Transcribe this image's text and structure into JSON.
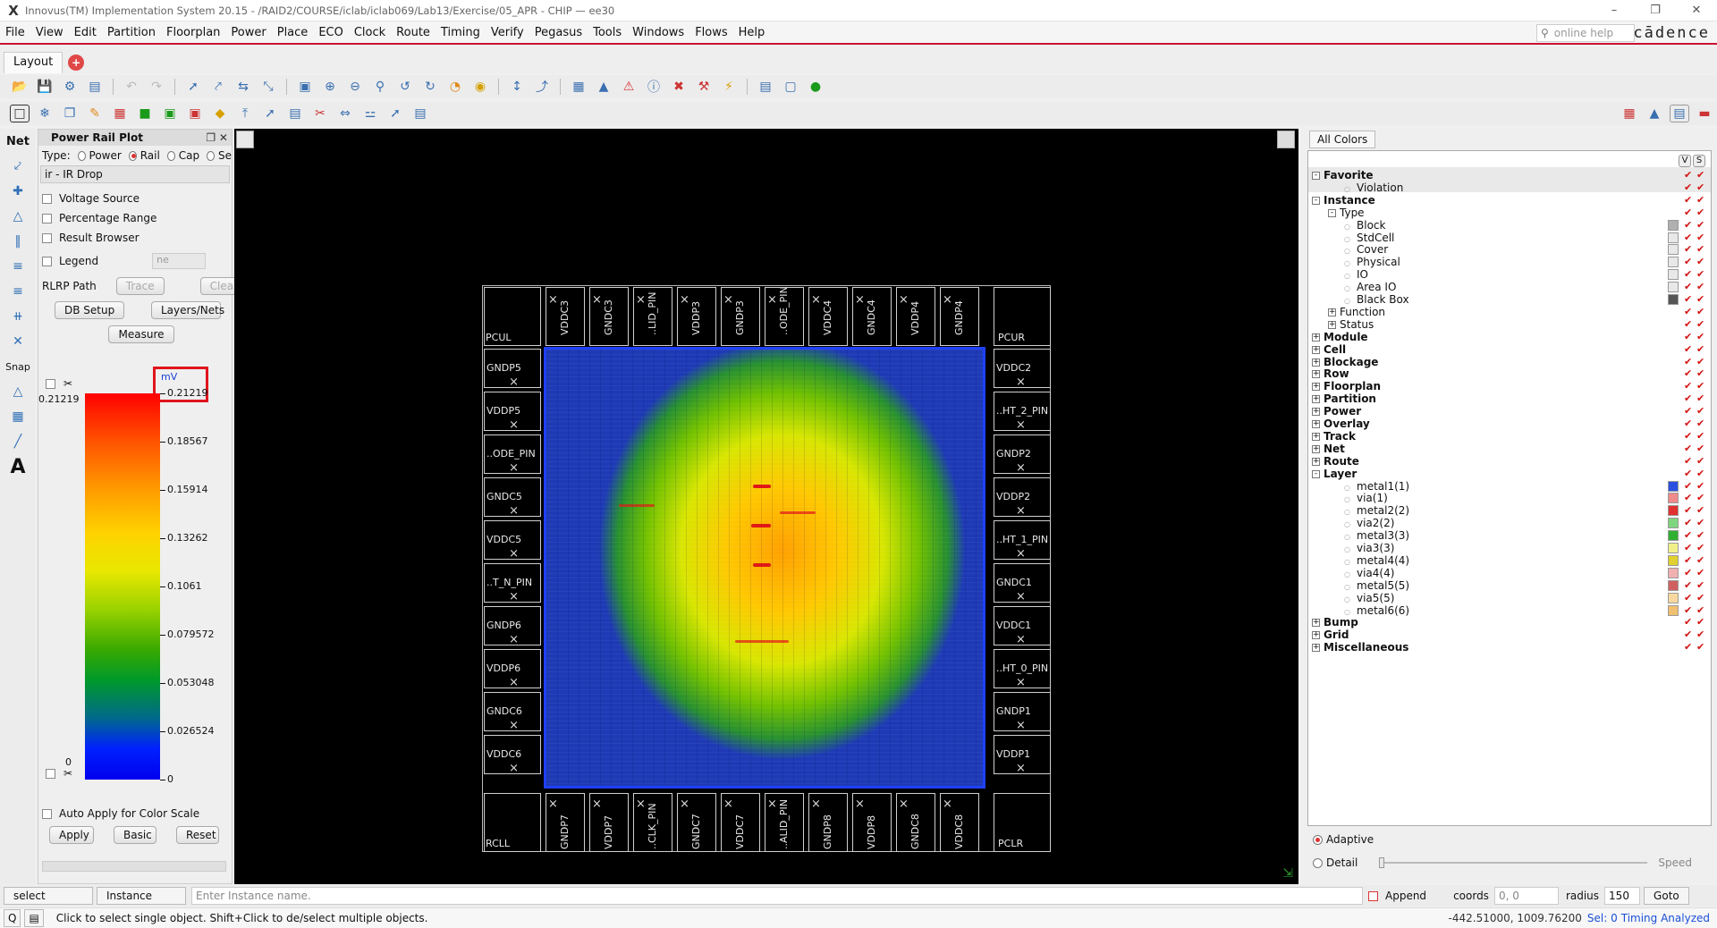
{
  "window": {
    "title": "Innovus(TM) Implementation System 20.15 - /RAID2/COURSE/iclab/iclab069/Lab13/Exercise/05_APR - CHIP — ee30"
  },
  "menu": [
    "File",
    "View",
    "Edit",
    "Partition",
    "Floorplan",
    "Power",
    "Place",
    "ECO",
    "Clock",
    "Route",
    "Timing",
    "Verify",
    "Pegasus",
    "Tools",
    "Windows",
    "Flows",
    "Help"
  ],
  "search": {
    "placeholder": "online help"
  },
  "brand": "cādence",
  "tabs": [
    {
      "label": "Layout"
    }
  ],
  "left_tools": {
    "net_label": "Net",
    "snap_label": "Snap",
    "text_tool": "A"
  },
  "power_rail_plot": {
    "title": "Power Rail Plot",
    "type_label": "Type:",
    "types": [
      "Power",
      "Rail",
      "Cap",
      "Se"
    ],
    "selected_type": "Rail",
    "analysis": "ir - IR Drop",
    "options": [
      "Voltage Source",
      "Percentage Range",
      "Result Browser"
    ],
    "legend_label": "Legend",
    "legend_select": "ne",
    "rlrp_label": "RLRP Path",
    "trace_label": "Trace",
    "clear_label": "Clear",
    "db_setup_label": "DB Setup",
    "layers_nets_label": "Layers/Nets",
    "measure_label": "Measure",
    "unit": "mV",
    "max_value": "0.21219",
    "scale_ticks": [
      "0.21219",
      "0.18567",
      "0.15914",
      "0.13262",
      "0.1061",
      "0.079572",
      "0.053048",
      "0.026524",
      "0"
    ],
    "min_left": "0",
    "auto_apply_label": "Auto Apply for Color Scale",
    "apply_label": "Apply",
    "basic_label": "Basic",
    "reset_label": "Reset"
  },
  "layout": {
    "corners": [
      "PCUL",
      "PCUR",
      "RCLL",
      "PCLR"
    ],
    "top_pads": [
      "VDDC3",
      "GNDC3",
      "..LID_PIN",
      "VDDP3",
      "GNDP3",
      "..ODE_PIN",
      "VDDC4",
      "GNDC4",
      "VDDP4",
      "GNDP4"
    ],
    "bottom_pads": [
      "GNDP7",
      "VDDP7",
      "..CLK_PIN",
      "GNDC7",
      "VDDC7",
      "..ALID_PIN",
      "GNDP8",
      "VDDP8",
      "GNDC8",
      "VDDC8"
    ],
    "left_pads": [
      "GNDP5",
      "VDDP5",
      "..ODE_PIN",
      "GNDC5",
      "VDDC5",
      "..T_N_PIN",
      "GNDP6",
      "VDDP6",
      "GNDC6",
      "VDDC6"
    ],
    "right_pads": [
      "VDDC2",
      "..HT_2_PIN",
      "GNDP2",
      "VDDP2",
      "..HT_1_PIN",
      "GNDC1",
      "VDDC1",
      "..HT_0_PIN",
      "GNDP1",
      "VDDP1"
    ]
  },
  "color_panel": {
    "all_colors_label": "All Colors",
    "v_label": "V",
    "s_label": "S",
    "tree": [
      {
        "label": "Favorite",
        "level": 0,
        "bold": true,
        "exp": "-"
      },
      {
        "label": "Violation",
        "level": 2,
        "bold": false,
        "exp": ""
      },
      {
        "label": "Instance",
        "level": 0,
        "bold": true,
        "exp": "-"
      },
      {
        "label": "Type",
        "level": 1,
        "bold": false,
        "exp": "-"
      },
      {
        "label": "Block",
        "level": 2,
        "bold": false,
        "exp": "",
        "sw": "#b0b0b0"
      },
      {
        "label": "StdCell",
        "level": 2,
        "bold": false,
        "exp": "",
        "sw": "#e8e8e8"
      },
      {
        "label": "Cover",
        "level": 2,
        "bold": false,
        "exp": "",
        "sw": "#e8e8e8"
      },
      {
        "label": "Physical",
        "level": 2,
        "bold": false,
        "exp": "",
        "sw": "#e8e8e8"
      },
      {
        "label": "IO",
        "level": 2,
        "bold": false,
        "exp": "",
        "sw": "#e8e8e8"
      },
      {
        "label": "Area IO",
        "level": 2,
        "bold": false,
        "exp": "",
        "sw": "#e8e8e8"
      },
      {
        "label": "Black Box",
        "level": 2,
        "bold": false,
        "exp": "",
        "sw": "#555555"
      },
      {
        "label": "Function",
        "level": 1,
        "bold": false,
        "exp": "+"
      },
      {
        "label": "Status",
        "level": 1,
        "bold": false,
        "exp": "+"
      },
      {
        "label": "Module",
        "level": 0,
        "bold": true,
        "exp": "+"
      },
      {
        "label": "Cell",
        "level": 0,
        "bold": true,
        "exp": "+"
      },
      {
        "label": "Blockage",
        "level": 0,
        "bold": true,
        "exp": "+"
      },
      {
        "label": "Row",
        "level": 0,
        "bold": true,
        "exp": "+"
      },
      {
        "label": "Floorplan",
        "level": 0,
        "bold": true,
        "exp": "+"
      },
      {
        "label": "Partition",
        "level": 0,
        "bold": true,
        "exp": "+"
      },
      {
        "label": "Power",
        "level": 0,
        "bold": true,
        "exp": "+"
      },
      {
        "label": "Overlay",
        "level": 0,
        "bold": true,
        "exp": "+"
      },
      {
        "label": "Track",
        "level": 0,
        "bold": true,
        "exp": "+"
      },
      {
        "label": "Net",
        "level": 0,
        "bold": true,
        "exp": "+"
      },
      {
        "label": "Route",
        "level": 0,
        "bold": true,
        "exp": "+"
      },
      {
        "label": "Layer",
        "level": 0,
        "bold": true,
        "exp": "-"
      },
      {
        "label": "metal1(1)",
        "level": 2,
        "bold": false,
        "exp": "",
        "sw": "#2a4fe0"
      },
      {
        "label": "via(1)",
        "level": 2,
        "bold": false,
        "exp": "",
        "sw": "#f08a8a"
      },
      {
        "label": "metal2(2)",
        "level": 2,
        "bold": false,
        "exp": "",
        "sw": "#e03030"
      },
      {
        "label": "via2(2)",
        "level": 2,
        "bold": false,
        "exp": "",
        "sw": "#7ed67e"
      },
      {
        "label": "metal3(3)",
        "level": 2,
        "bold": false,
        "exp": "",
        "sw": "#30b030"
      },
      {
        "label": "via3(3)",
        "level": 2,
        "bold": false,
        "exp": "",
        "sw": "#f0f08a"
      },
      {
        "label": "metal4(4)",
        "level": 2,
        "bold": false,
        "exp": "",
        "sw": "#e0d030"
      },
      {
        "label": "via4(4)",
        "level": 2,
        "bold": false,
        "exp": "",
        "sw": "#f0b0b0"
      },
      {
        "label": "metal5(5)",
        "level": 2,
        "bold": false,
        "exp": "",
        "sw": "#d06060"
      },
      {
        "label": "via5(5)",
        "level": 2,
        "bold": false,
        "exp": "",
        "sw": "#f8d8a0"
      },
      {
        "label": "metal6(6)",
        "level": 2,
        "bold": false,
        "exp": "",
        "sw": "#f0c070"
      },
      {
        "label": "Bump",
        "level": 0,
        "bold": true,
        "exp": "+"
      },
      {
        "label": "Grid",
        "level": 0,
        "bold": true,
        "exp": "+"
      },
      {
        "label": "Miscellaneous",
        "level": 0,
        "bold": true,
        "exp": "+"
      }
    ],
    "adaptive_label": "Adaptive",
    "detail_label": "Detail",
    "speed_label": "Speed"
  },
  "selection_bar": {
    "mode": "select",
    "object": "Instance",
    "placeholder": "Enter Instance name.",
    "append_label": "Append",
    "coords_label": "coords",
    "coords_value": "0, 0",
    "radius_label": "radius",
    "radius_value": "150",
    "goto_label": "Goto"
  },
  "status": {
    "q": "Q",
    "message": "Click to select single object. Shift+Click to de/select multiple objects.",
    "coords": "-442.51000, 1009.76200",
    "sel": "Sel: 0",
    "timing": "Timing Analyzed"
  }
}
